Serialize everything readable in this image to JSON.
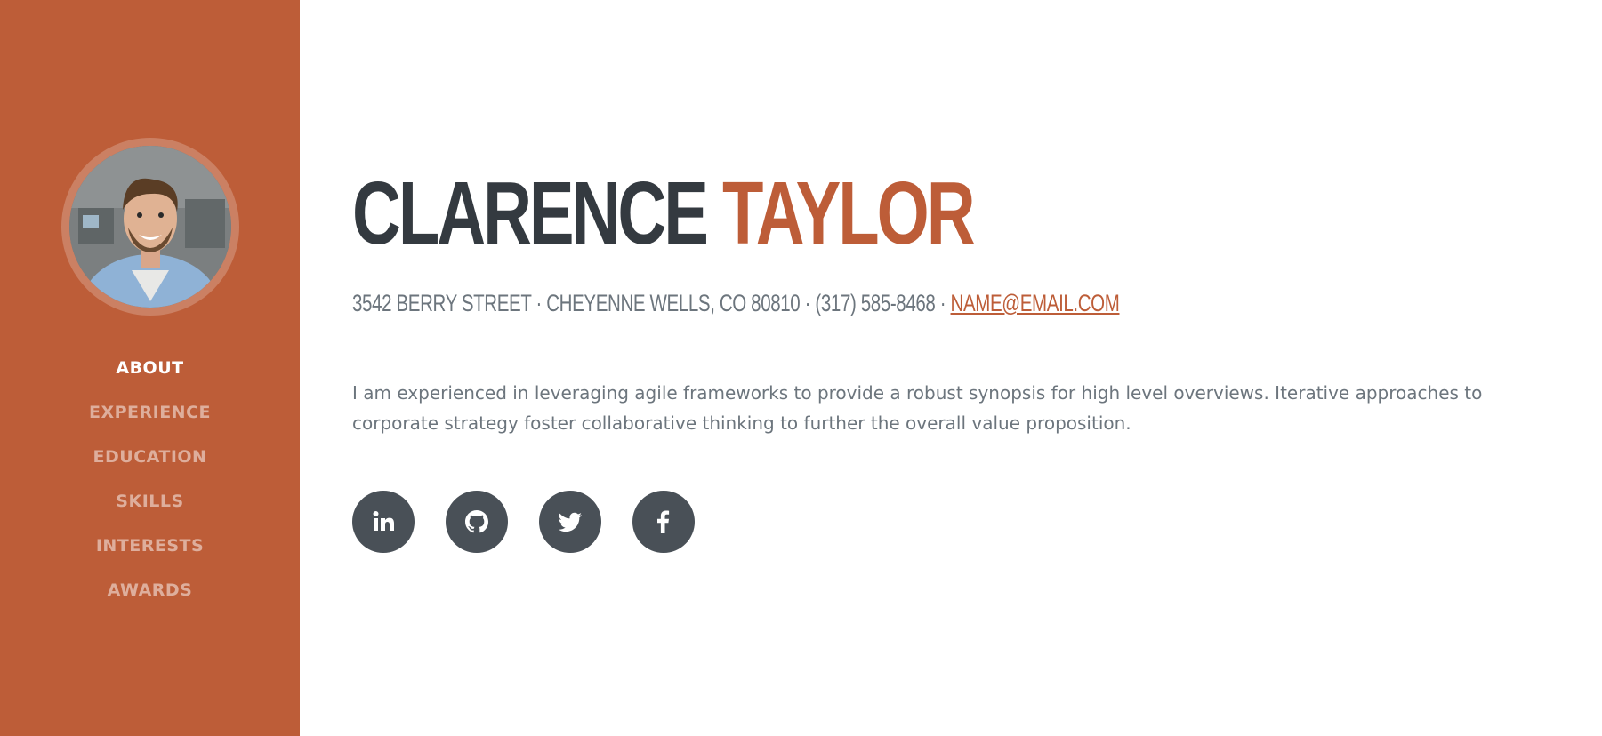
{
  "profile": {
    "first_name": "CLARENCE",
    "last_name": "TAYLOR",
    "address": "3542 BERRY STREET · CHEYENNE WELLS, CO 80810 · (317) 585-8468 · ",
    "email": "NAME@EMAIL.COM",
    "about": "I am experienced in leveraging agile frameworks to provide a robust synopsis for high level overviews. Iterative approaches to corporate strategy foster collaborative thinking to further the overall value proposition."
  },
  "nav": {
    "items": [
      {
        "label": "ABOUT",
        "active": true
      },
      {
        "label": "EXPERIENCE",
        "active": false
      },
      {
        "label": "EDUCATION",
        "active": false
      },
      {
        "label": "SKILLS",
        "active": false
      },
      {
        "label": "INTERESTS",
        "active": false
      },
      {
        "label": "AWARDS",
        "active": false
      }
    ]
  },
  "social": {
    "items": [
      {
        "icon": "linkedin-icon"
      },
      {
        "icon": "github-icon"
      },
      {
        "icon": "twitter-icon"
      },
      {
        "icon": "facebook-icon"
      }
    ]
  },
  "colors": {
    "primary": "#bd5d38",
    "dark": "#343a40",
    "muted": "#6c757d",
    "social_bg": "#495057"
  }
}
